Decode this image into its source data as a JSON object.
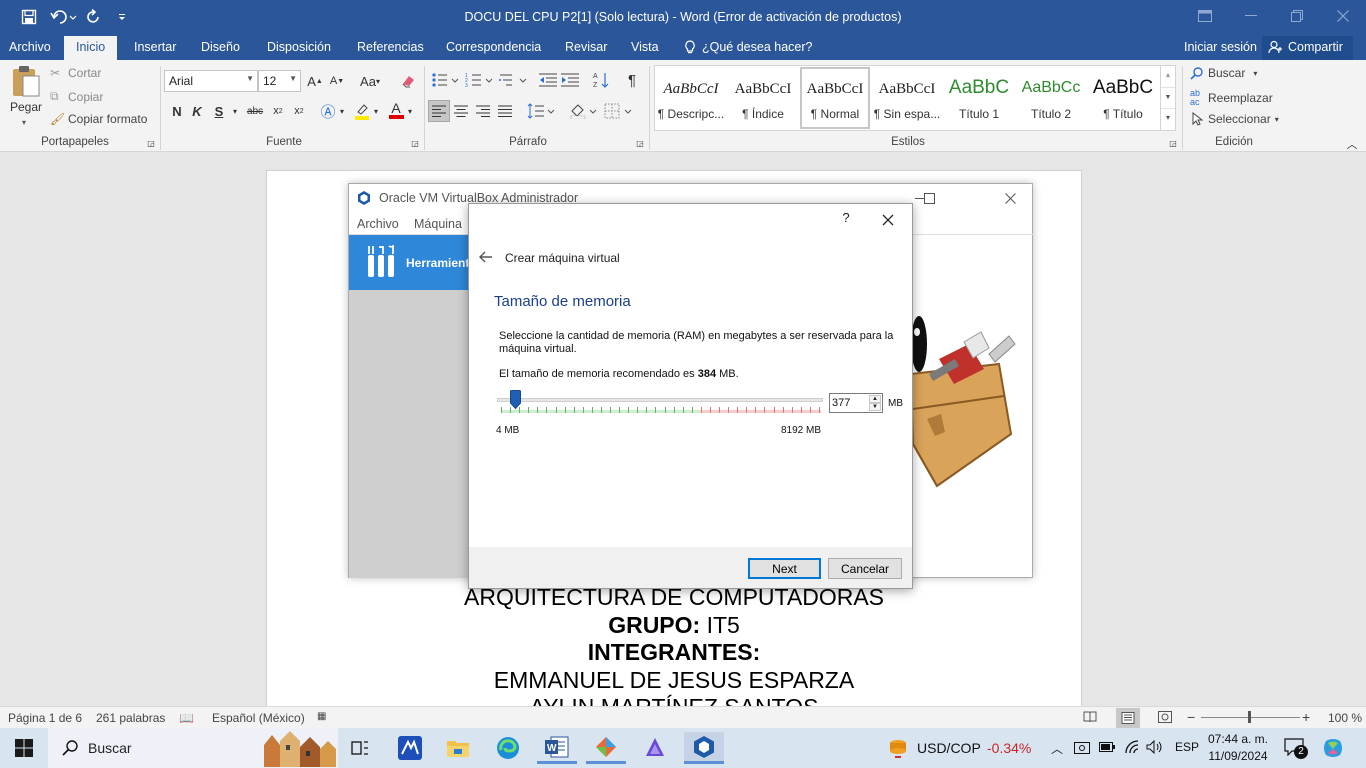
{
  "word": {
    "title": "DOCU DEL CPU P2[1] (Solo lectura)  -  Word (Error de activación de productos)",
    "tabs": [
      "Archivo",
      "Inicio",
      "Insertar",
      "Diseño",
      "Disposición",
      "Referencias",
      "Correspondencia",
      "Revisar",
      "Vista"
    ],
    "tell_me": "¿Qué desea hacer?",
    "sign_in": "Iniciar sesión",
    "share": "Compartir",
    "clipboard": {
      "paste": "Pegar",
      "cut": "Cortar",
      "copy": "Copiar",
      "format_painter": "Copiar formato",
      "label": "Portapapeles"
    },
    "font": {
      "name": "Arial",
      "size": "12",
      "label": "Fuente",
      "bold": "N",
      "italic": "K",
      "underline": "S"
    },
    "paragraph": {
      "label": "Párrafo"
    },
    "styles": {
      "label": "Estilos",
      "items": [
        {
          "preview": "AaBbCcI",
          "name": "¶ Descripc...",
          "color": "#222"
        },
        {
          "preview": "AaBbCcI",
          "name": "¶ Índice",
          "color": "#222"
        },
        {
          "preview": "AaBbCcI",
          "name": "¶ Normal",
          "color": "#222"
        },
        {
          "preview": "AaBbCcI",
          "name": "¶ Sin espa...",
          "color": "#222"
        },
        {
          "preview": "AaBbC",
          "name": "Título 1",
          "color": "#2e8b2e"
        },
        {
          "preview": "AaBbCc",
          "name": "Título 2",
          "color": "#2e8b2e"
        },
        {
          "preview": "AaBbC",
          "name": "¶ Título",
          "color": "#111"
        }
      ]
    },
    "editing": {
      "find": "Buscar",
      "replace": "Reemplazar",
      "select": "Seleccionar",
      "label": "Edición"
    }
  },
  "document": {
    "lines": [
      {
        "text": "ARQUITECTURA DE COMPUTADORAS",
        "bold": ""
      },
      {
        "bold": "GRUPO:",
        "text": " IT5"
      },
      {
        "bold": "INTEGRANTES:",
        "text": ""
      },
      {
        "text": "EMMANUEL DE JESUS ESPARZA",
        "bold": ""
      },
      {
        "text": "AYLIN MARTÍNEZ SANTOS",
        "bold": ""
      }
    ]
  },
  "virtualbox": {
    "title": "Oracle VM VirtualBox Administrador",
    "menu": [
      "Archivo",
      "Máquina"
    ],
    "tools": "Herramientas"
  },
  "dialog": {
    "help": "?",
    "header": "Crear máquina virtual",
    "section": "Tamaño de memoria",
    "description": "Seleccione la cantidad de memoria (RAM) en megabytes a ser reservada para la máquina virtual.",
    "recommended_prefix": "El tamaño de memoria recomendado es ",
    "recommended_value": "384",
    "recommended_suffix": " MB.",
    "memory_value": "377",
    "unit": "MB",
    "min_label": "4 MB",
    "max_label": "8192 MB",
    "slider_min": 4,
    "slider_max": 8192,
    "slider_value": 377,
    "next": "Next",
    "cancel": "Cancelar"
  },
  "status": {
    "page": "Página 1 de 6",
    "words": "261 palabras",
    "language": "Español (México)",
    "zoom": "100 %"
  },
  "taskbar": {
    "search": "Buscar",
    "ticker_name": "USD/COP",
    "ticker_change": "-0.34%",
    "lang": "ESP",
    "time": "07:44 a. m.",
    "date": "11/09/2024",
    "notifications": "2"
  }
}
